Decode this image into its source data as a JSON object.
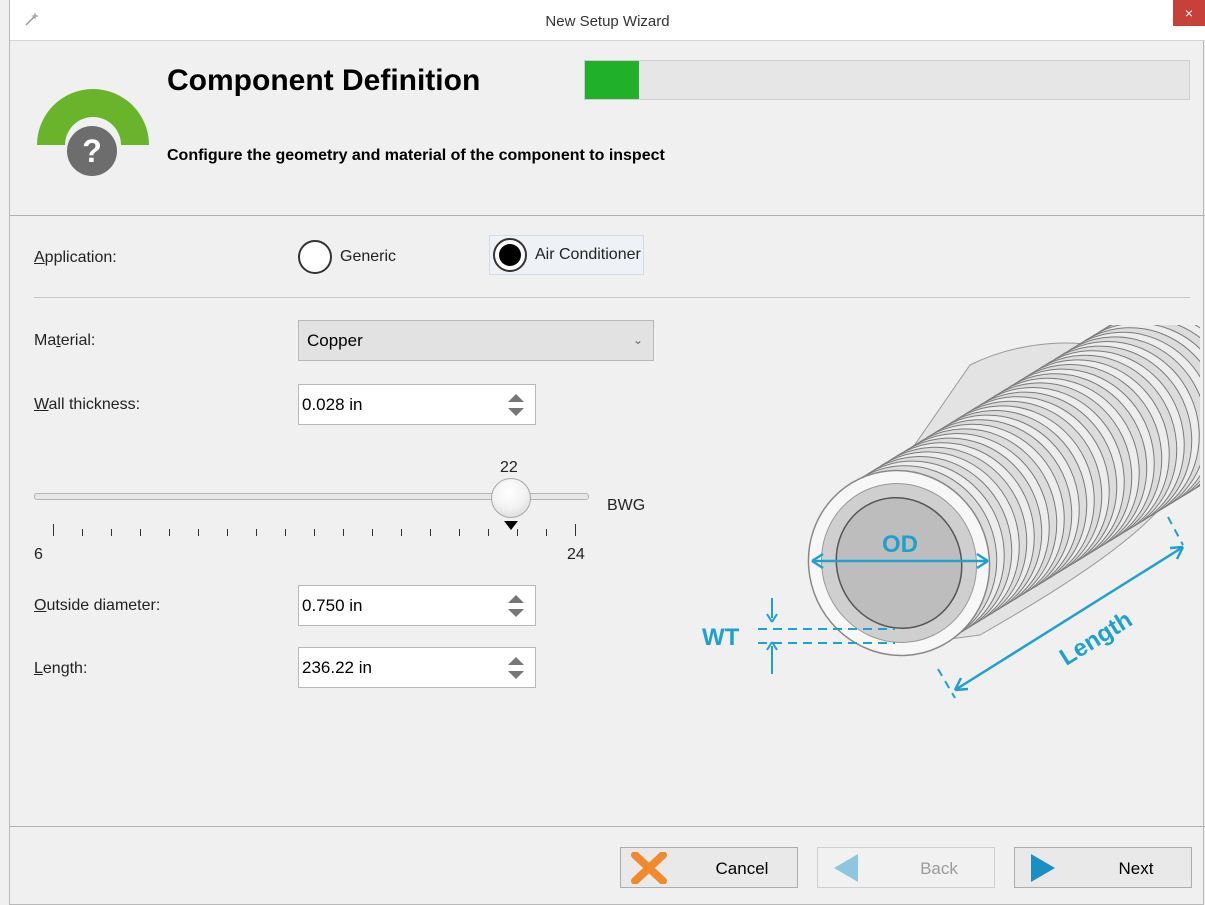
{
  "window": {
    "title": "New Setup Wizard",
    "close_label": "×"
  },
  "header": {
    "title": "Component Definition",
    "subtitle": "Configure the geometry and material of the component to inspect",
    "progress_fraction": 0.09
  },
  "application": {
    "label_pre": "Application:",
    "options": [
      {
        "label": "Generic",
        "checked": false
      },
      {
        "label": "Air Conditioner",
        "checked": true
      }
    ]
  },
  "material": {
    "label_pre": "Ma",
    "label_u": "t",
    "label_post": "erial:",
    "value": "Copper"
  },
  "wall_thickness": {
    "label_u": "W",
    "label_post": "all thickness:",
    "value": "0.028 in"
  },
  "bwg_slider": {
    "value": "22",
    "min": "6",
    "max": "24",
    "unit": "BWG"
  },
  "outside_diameter": {
    "label_u": "O",
    "label_post": "utside diameter:",
    "value": "0.750 in"
  },
  "length": {
    "label_u": "L",
    "label_post": "ength:",
    "value": "236.22 in"
  },
  "diagram": {
    "od": "OD",
    "wt": "WT",
    "length": "Length"
  },
  "footer": {
    "cancel": "Cancel",
    "back": "Back",
    "next": "Next"
  },
  "colors": {
    "accent_green": "#21b02a",
    "diagram_blue": "#1ea1cf",
    "logo_green": "#6ab42c"
  }
}
